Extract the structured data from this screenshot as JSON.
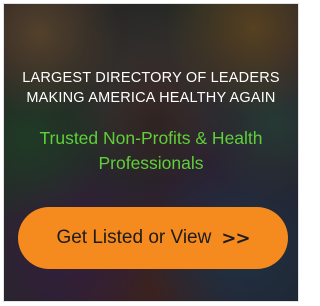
{
  "ad": {
    "headline_line1": "LARGEST DIRECTORY OF LEADERS",
    "headline_line2": "MAKING AMERICA HEALTHY AGAIN",
    "subhead_line1": "Trusted Non-Profits & Health",
    "subhead_line2": "Professionals",
    "cta_label": "Get Listed or View",
    "cta_arrows": ">>",
    "colors": {
      "headline": "#ffffff",
      "subhead": "#5fcf3a",
      "button_bg": "#f58a1f",
      "button_text": "#1c1c1c"
    },
    "background_image": "colorful-portrait-collage"
  }
}
